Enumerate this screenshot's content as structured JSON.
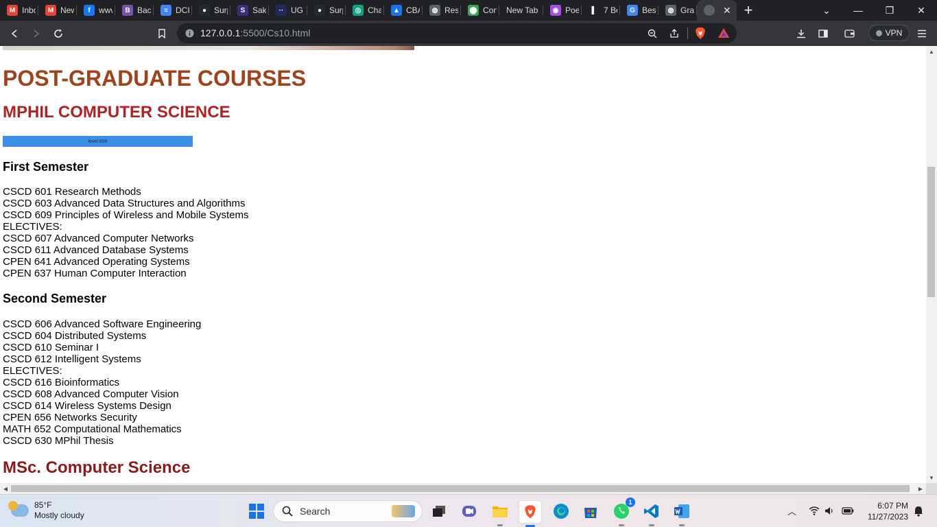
{
  "browser": {
    "tabs": [
      {
        "title": "Inbox",
        "icon": "gmail-icon",
        "color": "#ea4335",
        "glyph": "M"
      },
      {
        "title": "New",
        "icon": "gmail-icon",
        "color": "#ea4335",
        "glyph": "M"
      },
      {
        "title": "www",
        "icon": "facebook-icon",
        "color": "#1877f2",
        "glyph": "f"
      },
      {
        "title": "Back",
        "icon": "bootstrap-icon",
        "color": "#7952b3",
        "glyph": "B"
      },
      {
        "title": "DCI",
        "icon": "docs-icon",
        "color": "#4285f4",
        "glyph": "≡"
      },
      {
        "title": "Surp",
        "icon": "github-icon",
        "color": "#24292e",
        "glyph": "●"
      },
      {
        "title": "Saka",
        "icon": "sakai-icon",
        "color": "#3b2e7e",
        "glyph": "S"
      },
      {
        "title": "UG",
        "icon": "ug-icon",
        "color": "#1f2a5a",
        "glyph": "··"
      },
      {
        "title": "Surp",
        "icon": "github-icon",
        "color": "#24292e",
        "glyph": "●"
      },
      {
        "title": "Chat",
        "icon": "openai-icon",
        "color": "#10a37f",
        "glyph": "◎"
      },
      {
        "title": "CBA",
        "icon": "cba-icon",
        "color": "#1a73e8",
        "glyph": "▲"
      },
      {
        "title": "Rese",
        "icon": "globe-icon",
        "color": "#5f6368",
        "glyph": "◍"
      },
      {
        "title": "Con",
        "icon": "maps-icon",
        "color": "#34a853",
        "glyph": "⬤"
      },
      {
        "title": "New Tab",
        "icon": "",
        "color": "#202124",
        "glyph": ""
      },
      {
        "title": "Poe",
        "icon": "poe-icon",
        "color": "#a64ee8",
        "glyph": "◉"
      },
      {
        "title": "7 Be",
        "icon": "bookmark-icon",
        "color": "#202124",
        "glyph": "▌"
      },
      {
        "title": "Best",
        "icon": "google-icon",
        "color": "#4285f4",
        "glyph": "G"
      },
      {
        "title": "Grad",
        "icon": "globe-icon",
        "color": "#5f6368",
        "glyph": "◍"
      }
    ],
    "active_tab_close": "✕",
    "new_tab_symbol": "+",
    "url_host": "127.0.0.1",
    "url_path": ":5500/Cs10.html",
    "vpn_label": "VPN"
  },
  "page": {
    "heading": "POST-GRADUATE COURSES",
    "program": "MPHIL COMPUTER SCIENCE",
    "level_label": "level 600",
    "first_semester": {
      "title": "First Semester",
      "courses": [
        "CSCD 601 Research Methods",
        "CSCD 603 Advanced Data Structures and Algorithms",
        "CSCD 609 Principles of Wireless and Mobile Systems",
        "ELECTIVES:",
        "CSCD 607 Advanced Computer Networks",
        "CSCD 611 Advanced Database Systems",
        "CPEN 641 Advanced Operating Systems",
        "CPEN 637 Human Computer Interaction"
      ]
    },
    "second_semester": {
      "title": "Second Semester",
      "courses": [
        "CSCD 606 Advanced Software Engineering",
        "CSCD 604 Distributed Systems",
        "CSCD 610 Seminar I",
        "CSCD 612 Intelligent Systems",
        "ELECTIVES:",
        "CSCD 616 Bioinformatics",
        "CSCD 608 Advanced Computer Vision",
        "CSCD 614 Wireless Systems Design",
        "CPEN 656 Networks Security",
        "MATH 652 Computational Mathematics",
        "CSCD 630 MPhil Thesis"
      ]
    },
    "next_program": "MSc. Computer Science"
  },
  "taskbar": {
    "weather_temp": "85°F",
    "weather_desc": "Mostly cloudy",
    "search_placeholder": "Search",
    "whatsapp_badge": "1",
    "time": "6:07 PM",
    "date": "11/27/2023"
  }
}
